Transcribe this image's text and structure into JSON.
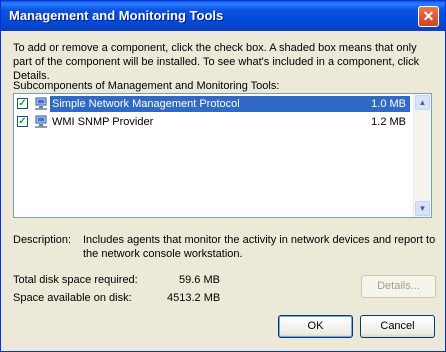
{
  "window": {
    "title": "Management and Monitoring Tools"
  },
  "instructions": "To add or remove a component, click the check box. A shaded box means that only part of the component will be installed. To see what's included in a component, click Details.",
  "subcomponents_label": "Subcomponents of Management and Monitoring Tools:",
  "components": [
    {
      "name": "Simple Network Management Protocol",
      "size": "1.0 MB",
      "checked": true,
      "selected": true,
      "icon": "network-computer-icon"
    },
    {
      "name": "WMI SNMP Provider",
      "size": "1.2 MB",
      "checked": true,
      "selected": false,
      "icon": "network-computer-icon"
    }
  ],
  "description": {
    "label": "Description:",
    "line1": "Includes agents that monitor the activity in network devices and report to",
    "line2": "the network console workstation."
  },
  "disk": {
    "required_label": "Total disk space required:",
    "required_value": "59.6 MB",
    "available_label": "Space available on disk:",
    "available_value": "4513.2 MB"
  },
  "buttons": {
    "details": "Details...",
    "ok": "OK",
    "cancel": "Cancel",
    "close": "✕"
  },
  "colors": {
    "titlebar": "#0a54e0",
    "selection": "#316ac5",
    "dialog_bg": "#ece9d8"
  }
}
